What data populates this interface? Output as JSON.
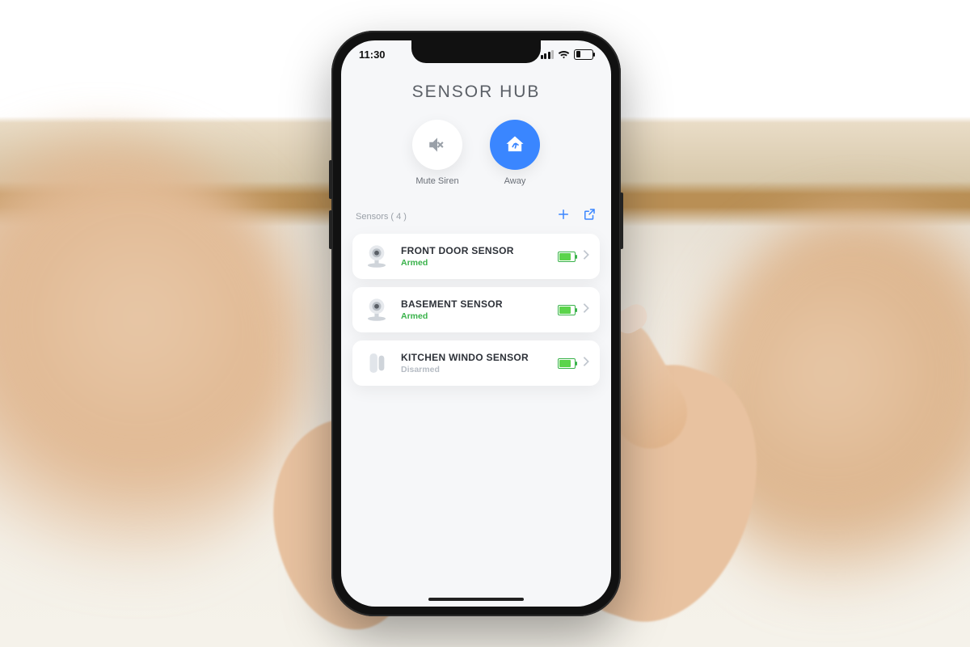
{
  "status": {
    "time": "11:30"
  },
  "title": "SENSOR HUB",
  "modes": {
    "mute": {
      "label": "Mute Siren"
    },
    "away": {
      "label": "Away"
    }
  },
  "list": {
    "header": "Sensors  ( 4 )"
  },
  "sensors": [
    {
      "name": "FRONT DOOR SENSOR",
      "state": "Armed",
      "stateClass": "armed",
      "icon": "camera"
    },
    {
      "name": "BASEMENT SENSOR",
      "state": "Armed",
      "stateClass": "armed",
      "icon": "camera"
    },
    {
      "name": "KITCHEN WINDO SENSOR",
      "state": "Disarmed",
      "stateClass": "disarmed",
      "icon": "contact"
    }
  ],
  "colors": {
    "accent": "#3a86ff",
    "good": "#39b24a"
  }
}
